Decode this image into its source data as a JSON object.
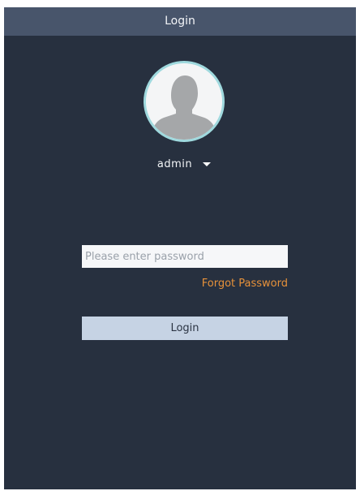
{
  "dialog": {
    "title": "Login"
  },
  "user": {
    "avatar_icon": "user-silhouette-icon",
    "name": "admin",
    "dropdown_icon": "caret-down-icon"
  },
  "password": {
    "placeholder": "Please enter password",
    "value": ""
  },
  "links": {
    "forgot_password": "Forgot Password"
  },
  "actions": {
    "login_label": "Login"
  },
  "colors": {
    "background": "#27303f",
    "titlebar": "#48556b",
    "accent_link": "#e6913a",
    "button": "#c6d3e4",
    "avatar_ring": "#9fd9de"
  }
}
